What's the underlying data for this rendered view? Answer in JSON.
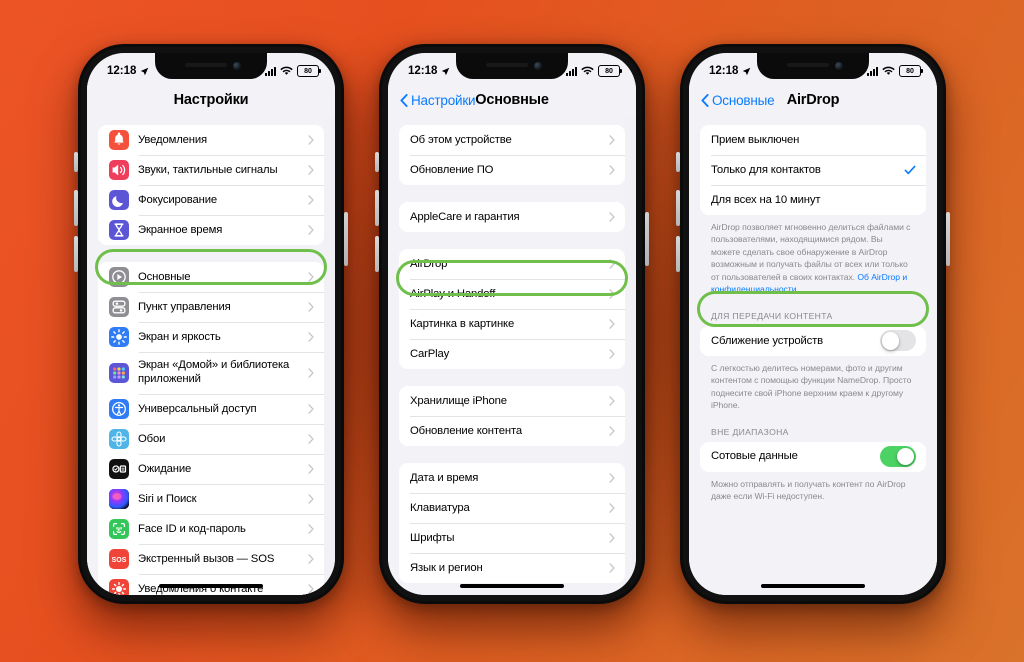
{
  "background": {
    "color": "#E8512A"
  },
  "highlight_color": "#6FBF4A",
  "status_bar": {
    "time": "12:18",
    "battery_text": "80",
    "location_icon": "location-arrow-icon",
    "signal_icon": "cellular-bars-icon",
    "wifi_icon": "wifi-icon"
  },
  "phone1": {
    "nav": {
      "title": "Настройки"
    },
    "groups": [
      {
        "rows": [
          {
            "label": "Уведомления",
            "icon": "notifications-bell-icon",
            "icon_bg": "#F4503C",
            "chevron": true
          },
          {
            "label": "Звуки, тактильные сигналы",
            "icon": "sounds-speaker-icon",
            "icon_bg": "#EE3E5B",
            "chevron": true
          },
          {
            "label": "Фокусирование",
            "icon": "focus-moon-icon",
            "icon_bg": "#5C56D6",
            "chevron": true
          },
          {
            "label": "Экранное время",
            "icon": "screen-time-hourglass-icon",
            "icon_bg": "#5C56D6",
            "chevron": true
          }
        ]
      },
      {
        "rows": [
          {
            "label": "Основные",
            "icon": "general-gear-icon",
            "icon_bg": "#8E8E93",
            "chevron": true,
            "highlighted": true
          },
          {
            "label": "Пункт управления",
            "icon": "control-center-icon",
            "icon_bg": "#8E8E93",
            "chevron": true
          },
          {
            "label": "Экран и яркость",
            "icon": "display-brightness-icon",
            "icon_bg": "#2F7CF6",
            "chevron": true
          },
          {
            "label": "Экран «Домой» и библиотека приложений",
            "icon": "home-screen-grid-icon",
            "icon_bg": "#5C56D6",
            "chevron": true
          },
          {
            "label": "Универсальный доступ",
            "icon": "accessibility-icon",
            "icon_bg": "#2F7CF6",
            "chevron": true
          },
          {
            "label": "Обои",
            "icon": "wallpaper-flower-icon",
            "icon_bg": "#4FB5E8",
            "chevron": true
          },
          {
            "label": "Ожидание",
            "icon": "standby-icon",
            "icon_bg": "#111111",
            "chevron": true
          },
          {
            "label": "Siri и Поиск",
            "icon": "siri-icon",
            "icon_bg": "#1B1030",
            "chevron": true
          },
          {
            "label": "Face ID и код-пароль",
            "icon": "face-id-icon",
            "icon_bg": "#33C759",
            "chevron": true
          },
          {
            "label": "Экстренный вызов — SOS",
            "icon": "sos-icon",
            "icon_bg": "#F04438",
            "chevron": true
          },
          {
            "label": "Уведомления о контакте",
            "icon": "contact-notify-icon",
            "icon_bg": "#F04438",
            "chevron": true
          }
        ]
      }
    ]
  },
  "phone2": {
    "nav": {
      "back": "Настройки",
      "title": "Основные"
    },
    "groups": [
      {
        "rows": [
          {
            "label": "Об этом устройстве",
            "chevron": true
          },
          {
            "label": "Обновление ПО",
            "chevron": true
          }
        ]
      },
      {
        "rows": [
          {
            "label": "AppleCare и гарантия",
            "chevron": true
          }
        ]
      },
      {
        "rows": [
          {
            "label": "AirDrop",
            "chevron": true,
            "highlighted": true
          },
          {
            "label": "AirPlay и Handoff",
            "chevron": true
          },
          {
            "label": "Картинка в картинке",
            "chevron": true
          },
          {
            "label": "CarPlay",
            "chevron": true
          }
        ]
      },
      {
        "rows": [
          {
            "label": "Хранилище iPhone",
            "chevron": true
          },
          {
            "label": "Обновление контента",
            "chevron": true
          }
        ]
      },
      {
        "rows": [
          {
            "label": "Дата и время",
            "chevron": true
          },
          {
            "label": "Клавиатура",
            "chevron": true
          },
          {
            "label": "Шрифты",
            "chevron": true
          },
          {
            "label": "Язык и регион",
            "chevron": true
          }
        ]
      }
    ]
  },
  "phone3": {
    "nav": {
      "back": "Основные",
      "title": "AirDrop"
    },
    "mode_options": [
      {
        "label": "Прием выключен",
        "selected": false
      },
      {
        "label": "Только для контактов",
        "selected": true
      },
      {
        "label": "Для всех на 10 минут",
        "selected": false
      }
    ],
    "airdrop_footnote": "AirDrop позволяет мгновенно делиться файлами с пользователями, находящимися рядом. Вы можете сделать свое обнаружение в AirDrop возможным и получать файлы от всех или только от пользователей в своих контактах. ",
    "airdrop_footnote_link": "Об AirDrop и конфиденциальности...",
    "section_transfer_header": "ДЛЯ ПЕРЕДАЧИ КОНТЕНТА",
    "proximity_row": {
      "label": "Сближение устройств",
      "enabled": false,
      "highlighted": true
    },
    "namedrop_footnote": "С легкостью делитесь номерами, фото и другим контентом с помощью функции NameDrop. Просто поднесите свой iPhone верхним краем к другому iPhone.",
    "section_range_header": "ВНЕ ДИАПАЗОНА",
    "cellular_row": {
      "label": "Сотовые данные",
      "enabled": true
    },
    "cellular_footnote": "Можно отправлять и получать контент по AirDrop даже если Wi-Fi недоступен."
  }
}
